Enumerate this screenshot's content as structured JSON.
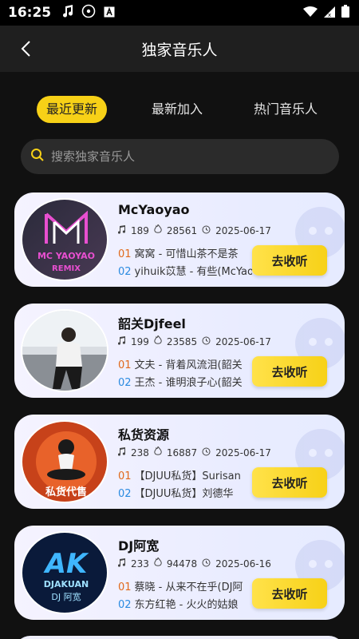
{
  "status_bar": {
    "time": "16:25"
  },
  "header": {
    "title": "独家音乐人"
  },
  "tabs": [
    {
      "label": "最近更新",
      "active": true
    },
    {
      "label": "最新加入",
      "active": false
    },
    {
      "label": "热门音乐人",
      "active": false
    }
  ],
  "search": {
    "placeholder": "搜索独家音乐人"
  },
  "artists": [
    {
      "name": "McYaoyao",
      "songs": "189",
      "plays": "28561",
      "date": "2025-06-17",
      "track1_no": "01",
      "track1": "窝窝 - 可惜山茶不是茶",
      "track2_no": "02",
      "track2": "yihuik苡慧 - 有些(McYao",
      "button": "去收听",
      "avatar_text": [
        "MC YAOYAO",
        "REMIX"
      ]
    },
    {
      "name": "韶关Djfeel",
      "songs": "199",
      "plays": "23585",
      "date": "2025-06-17",
      "track1_no": "01",
      "track1": "文夫 - 背着风流泪(韶关",
      "track2_no": "02",
      "track2": "王杰 - 谁明浪子心(韶关",
      "button": "去收听"
    },
    {
      "name": "私货资源",
      "songs": "238",
      "plays": "16887",
      "date": "2025-06-17",
      "track1_no": "01",
      "track1": "【DJUU私货】Surisan",
      "track2_no": "02",
      "track2": "【DJUU私货】刘德华",
      "button": "去收听",
      "avatar_text": [
        "私货代售"
      ]
    },
    {
      "name": "DJ阿宽",
      "songs": "233",
      "plays": "94478",
      "date": "2025-06-16",
      "track1_no": "01",
      "track1": "蔡晓 - 从来不在乎(DJ阿",
      "track2_no": "02",
      "track2": "东方红艳 - 火火的姑娘",
      "button": "去收听",
      "avatar_text": [
        "AK",
        "DJAKUAN",
        "DJ 阿宽"
      ]
    }
  ],
  "colors": {
    "accent": "#f7d117",
    "background": "#111111",
    "header": "#1f1f1f",
    "card": "#eef0ff"
  }
}
